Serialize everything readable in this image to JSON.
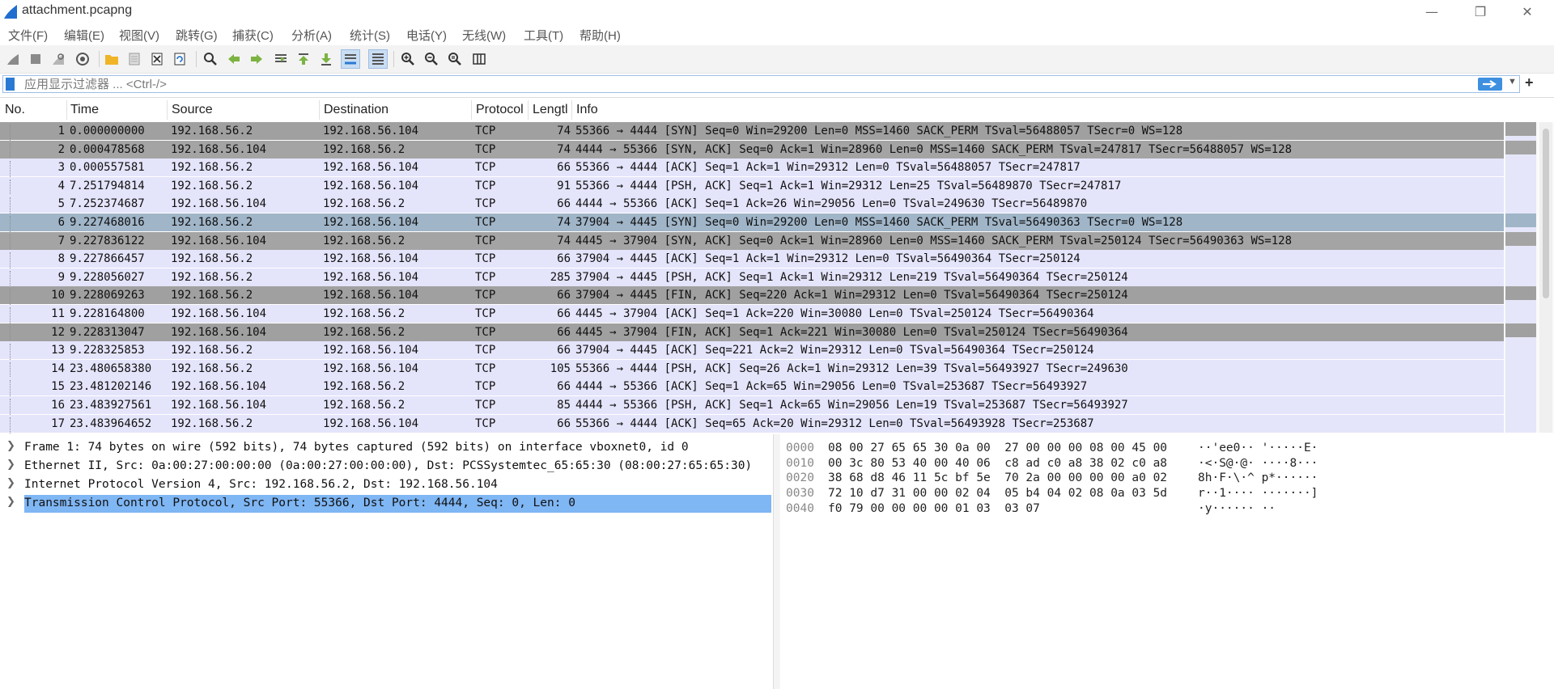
{
  "window": {
    "title": "attachment.pcapng"
  },
  "menu": [
    "文件(F)",
    "编辑(E)",
    "视图(V)",
    "跳转(G)",
    "捕获(C)",
    "分析(A)",
    "统计(S)",
    "电话(Y)",
    "无线(W)",
    "工具(T)",
    "帮助(H)"
  ],
  "toolbar": {
    "icons": [
      "start-capture-icon",
      "stop-capture-icon",
      "restart-capture-icon",
      "capture-options-icon",
      "open-file-icon",
      "save-file-icon",
      "close-file-icon",
      "reload-file-icon",
      "find-packet-icon",
      "go-back-icon",
      "go-forward-icon",
      "go-to-packet-icon",
      "go-first-icon",
      "go-last-icon",
      "auto-scroll-icon",
      "colorize-icon",
      "zoom-in-icon",
      "zoom-out-icon",
      "zoom-normal-icon",
      "resize-columns-icon"
    ]
  },
  "filter": {
    "placeholder": "应用显示过滤器 ... <Ctrl-/>"
  },
  "columns": [
    "No.",
    "Time",
    "Source",
    "Destination",
    "Protocol",
    "Lengtl",
    "Info"
  ],
  "packets": [
    {
      "no": "1",
      "time": "0.000000000",
      "src": "192.168.56.2",
      "dst": "192.168.56.104",
      "proto": "TCP",
      "len": "74",
      "info": "55366 → 4444 [SYN] Seq=0 Win=29200 Len=0 MSS=1460 SACK_PERM TSval=56488057 TSecr=0 WS=128",
      "color": "bg-syn"
    },
    {
      "no": "2",
      "time": "0.000478568",
      "src": "192.168.56.104",
      "dst": "192.168.56.2",
      "proto": "TCP",
      "len": "74",
      "info": "4444 → 55366 [SYN, ACK] Seq=0 Ack=1 Win=28960 Len=0 MSS=1460 SACK_PERM TSval=247817 TSecr=56488057 WS=128",
      "color": "bg-syn2"
    },
    {
      "no": "3",
      "time": "0.000557581",
      "src": "192.168.56.2",
      "dst": "192.168.56.104",
      "proto": "TCP",
      "len": "66",
      "info": "55366 → 4444 [ACK] Seq=1 Ack=1 Win=29312 Len=0 TSval=56488057 TSecr=247817",
      "color": "bg-norm"
    },
    {
      "no": "4",
      "time": "7.251794814",
      "src": "192.168.56.2",
      "dst": "192.168.56.104",
      "proto": "TCP",
      "len": "91",
      "info": "55366 → 4444 [PSH, ACK] Seq=1 Ack=1 Win=29312 Len=25 TSval=56489870 TSecr=247817",
      "color": "bg-norm"
    },
    {
      "no": "5",
      "time": "7.252374687",
      "src": "192.168.56.104",
      "dst": "192.168.56.2",
      "proto": "TCP",
      "len": "66",
      "info": "4444 → 55366 [ACK] Seq=1 Ack=26 Win=29056 Len=0 TSval=249630 TSecr=56489870",
      "color": "bg-norm"
    },
    {
      "no": "6",
      "time": "9.227468016",
      "src": "192.168.56.2",
      "dst": "192.168.56.104",
      "proto": "TCP",
      "len": "74",
      "info": "37904 → 4445 [SYN] Seq=0 Win=29200 Len=0 MSS=1460 SACK_PERM TSval=56490363 TSecr=0 WS=128",
      "color": "bg-blue"
    },
    {
      "no": "7",
      "time": "9.227836122",
      "src": "192.168.56.104",
      "dst": "192.168.56.2",
      "proto": "TCP",
      "len": "74",
      "info": "4445 → 37904 [SYN, ACK] Seq=0 Ack=1 Win=28960 Len=0 MSS=1460 SACK_PERM TSval=250124 TSecr=56490363 WS=128",
      "color": "bg-syn2"
    },
    {
      "no": "8",
      "time": "9.227866457",
      "src": "192.168.56.2",
      "dst": "192.168.56.104",
      "proto": "TCP",
      "len": "66",
      "info": "37904 → 4445 [ACK] Seq=1 Ack=1 Win=29312 Len=0 TSval=56490364 TSecr=250124",
      "color": "bg-norm"
    },
    {
      "no": "9",
      "time": "9.228056027",
      "src": "192.168.56.2",
      "dst": "192.168.56.104",
      "proto": "TCP",
      "len": "285",
      "info": "37904 → 4445 [PSH, ACK] Seq=1 Ack=1 Win=29312 Len=219 TSval=56490364 TSecr=250124",
      "color": "bg-norm"
    },
    {
      "no": "10",
      "time": "9.228069263",
      "src": "192.168.56.2",
      "dst": "192.168.56.104",
      "proto": "TCP",
      "len": "66",
      "info": "37904 → 4445 [FIN, ACK] Seq=220 Ack=1 Win=29312 Len=0 TSval=56490364 TSecr=250124",
      "color": "bg-fin"
    },
    {
      "no": "11",
      "time": "9.228164800",
      "src": "192.168.56.104",
      "dst": "192.168.56.2",
      "proto": "TCP",
      "len": "66",
      "info": "4445 → 37904 [ACK] Seq=1 Ack=220 Win=30080 Len=0 TSval=250124 TSecr=56490364",
      "color": "bg-norm"
    },
    {
      "no": "12",
      "time": "9.228313047",
      "src": "192.168.56.104",
      "dst": "192.168.56.2",
      "proto": "TCP",
      "len": "66",
      "info": "4445 → 37904 [FIN, ACK] Seq=1 Ack=221 Win=30080 Len=0 TSval=250124 TSecr=56490364",
      "color": "bg-fin"
    },
    {
      "no": "13",
      "time": "9.228325853",
      "src": "192.168.56.2",
      "dst": "192.168.56.104",
      "proto": "TCP",
      "len": "66",
      "info": "37904 → 4445 [ACK] Seq=221 Ack=2 Win=29312 Len=0 TSval=56490364 TSecr=250124",
      "color": "bg-norm"
    },
    {
      "no": "14",
      "time": "23.480658380",
      "src": "192.168.56.2",
      "dst": "192.168.56.104",
      "proto": "TCP",
      "len": "105",
      "info": "55366 → 4444 [PSH, ACK] Seq=26 Ack=1 Win=29312 Len=39 TSval=56493927 TSecr=249630",
      "color": "bg-norm"
    },
    {
      "no": "15",
      "time": "23.481202146",
      "src": "192.168.56.104",
      "dst": "192.168.56.2",
      "proto": "TCP",
      "len": "66",
      "info": "4444 → 55366 [ACK] Seq=1 Ack=65 Win=29056 Len=0 TSval=253687 TSecr=56493927",
      "color": "bg-norm"
    },
    {
      "no": "16",
      "time": "23.483927561",
      "src": "192.168.56.104",
      "dst": "192.168.56.2",
      "proto": "TCP",
      "len": "85",
      "info": "4444 → 55366 [PSH, ACK] Seq=1 Ack=65 Win=29056 Len=19 TSval=253687 TSecr=56493927",
      "color": "bg-norm"
    },
    {
      "no": "17",
      "time": "23.483964652",
      "src": "192.168.56.2",
      "dst": "192.168.56.104",
      "proto": "TCP",
      "len": "66",
      "info": "55366 → 4444 [ACK] Seq=65 Ack=20 Win=29312 Len=0 TSval=56493928 TSecr=253687",
      "color": "bg-norm"
    }
  ],
  "details": [
    "Frame 1: 74 bytes on wire (592 bits), 74 bytes captured (592 bits) on interface vboxnet0, id 0",
    "Ethernet II, Src: 0a:00:27:00:00:00 (0a:00:27:00:00:00), Dst: PCSSystemtec_65:65:30 (08:00:27:65:65:30)",
    "Internet Protocol Version 4, Src: 192.168.56.2, Dst: 192.168.56.104",
    "Transmission Control Protocol, Src Port: 55366, Dst Port: 4444, Seq: 0, Len: 0"
  ],
  "bytes": [
    {
      "off": "0000",
      "hex": "08 00 27 65 65 30 0a 00  27 00 00 00 08 00 45 00",
      "asc": "··'ee0·· '·····E·"
    },
    {
      "off": "0010",
      "hex": "00 3c 80 53 40 00 40 06  c8 ad c0 a8 38 02 c0 a8",
      "asc": "·<·S@·@· ····8···"
    },
    {
      "off": "0020",
      "hex": "38 68 d8 46 11 5c bf 5e  70 2a 00 00 00 00 a0 02",
      "asc": "8h·F·\\·^ p*······"
    },
    {
      "off": "0030",
      "hex": "72 10 d7 31 00 00 02 04  05 b4 04 02 08 0a 03 5d",
      "asc": "r··1···· ·······]"
    },
    {
      "off": "0040",
      "hex": "f0 79 00 00 00 00 01 03  03 07",
      "asc": "·y······ ··"
    }
  ]
}
